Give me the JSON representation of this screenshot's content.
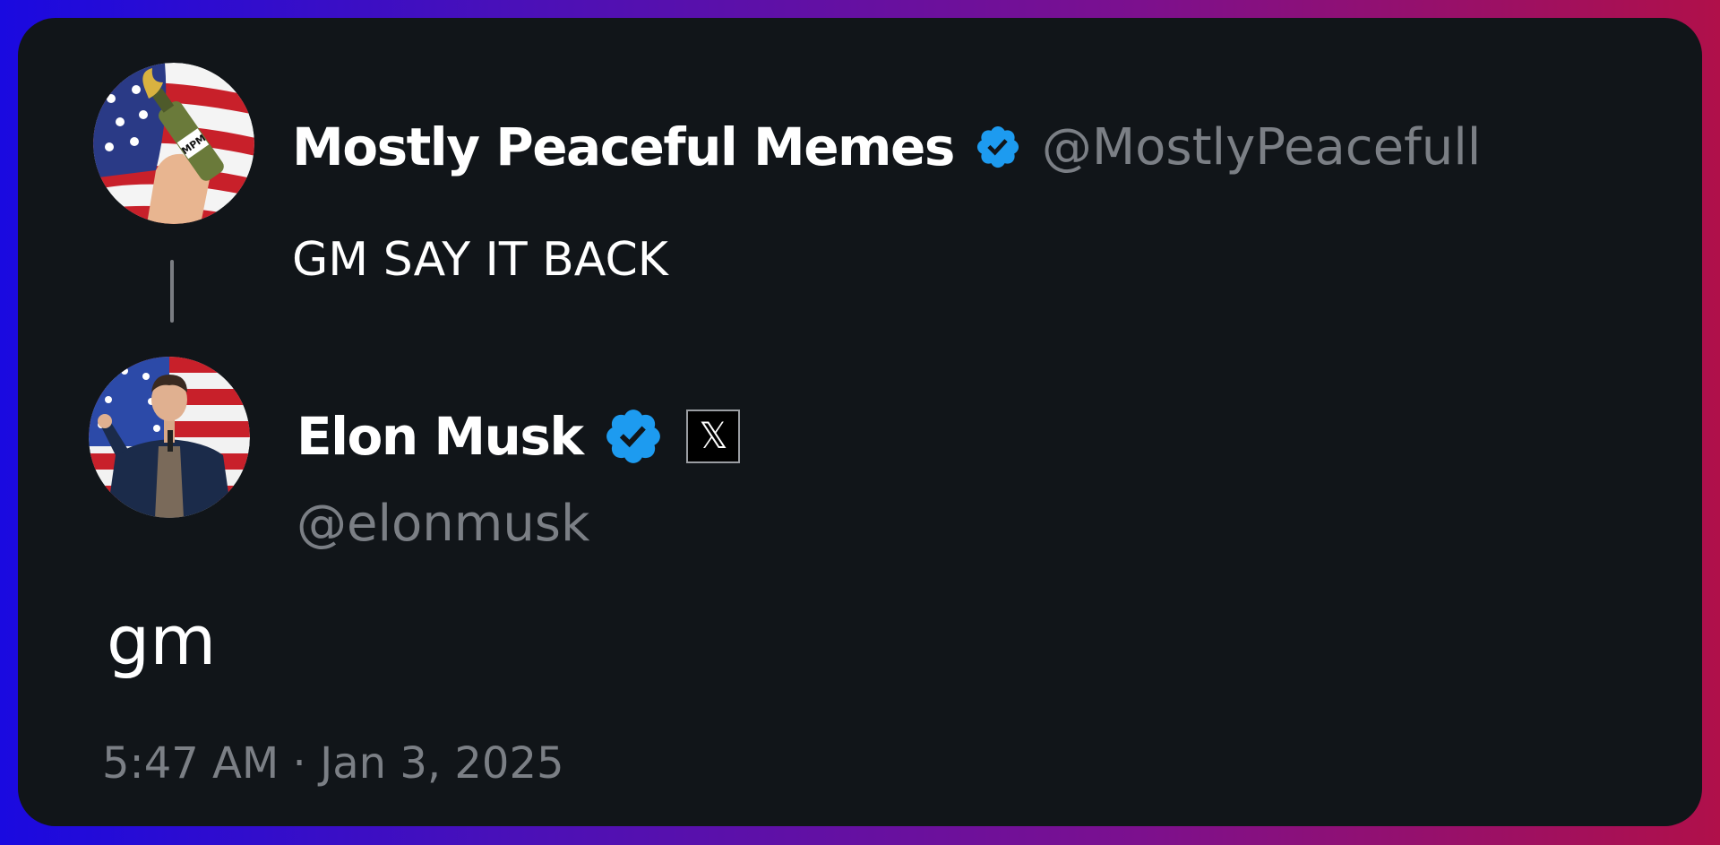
{
  "colors": {
    "card_background": "#111519",
    "verified_blue": "#1d9bf0",
    "handle_gray": "#7b7f85",
    "gradient_left": "#1a0ae0",
    "gradient_right": "#b0104a"
  },
  "quoted_post": {
    "display_name": "Mostly Peaceful Memes",
    "verified": true,
    "handle": "@MostlyPeacefull",
    "text": "GM SAY IT BACK",
    "avatar_icon": "flag-bottle-avatar"
  },
  "reply_post": {
    "display_name": "Elon Musk",
    "verified": true,
    "affiliate_badge_icon": "x-logo-icon",
    "handle": "@elonmusk",
    "text": "gm",
    "timestamp": "5:47 AM · Jan 3, 2025",
    "avatar_icon": "person-flag-avatar"
  }
}
